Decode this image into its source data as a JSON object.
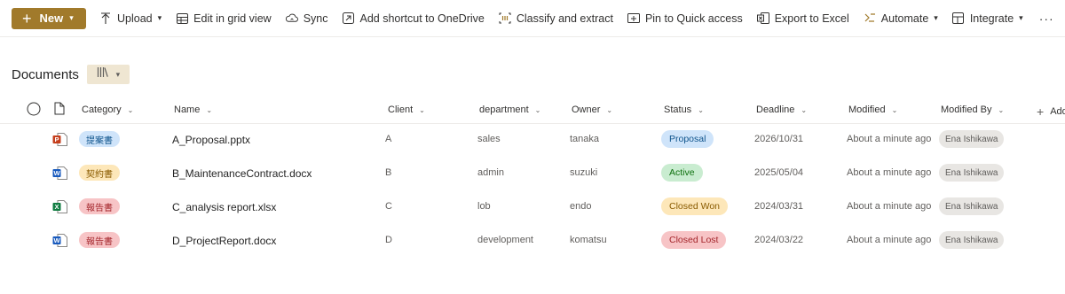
{
  "toolbar": {
    "new_label": "New",
    "upload_label": "Upload",
    "grid_label": "Edit in grid view",
    "sync_label": "Sync",
    "shortcut_label": "Add shortcut to OneDrive",
    "classify_label": "Classify and extract",
    "pin_label": "Pin to Quick access",
    "export_label": "Export to Excel",
    "automate_label": "Automate",
    "integrate_label": "Integrate",
    "more_label": "···"
  },
  "library": {
    "title": "Documents"
  },
  "columns": {
    "category": "Category",
    "name": "Name",
    "client": "Client",
    "department": "department",
    "owner": "Owner",
    "status": "Status",
    "deadline": "Deadline",
    "modified": "Modified",
    "modified_by": "Modified By",
    "add_column": "Add"
  },
  "files": [
    {
      "type": "pptx",
      "category": "提案書",
      "name": "A_Proposal.pptx",
      "client": "A",
      "department": "sales",
      "owner": "tanaka",
      "status": "Proposal",
      "deadline": "2026/10/31",
      "modified": "About a minute ago",
      "modified_by": "Ena Ishikawa"
    },
    {
      "type": "docx",
      "category": "契約書",
      "name": "B_MaintenanceContract.docx",
      "client": "B",
      "department": "admin",
      "owner": "suzuki",
      "status": "Active",
      "deadline": "2025/05/04",
      "modified": "About a minute ago",
      "modified_by": "Ena Ishikawa"
    },
    {
      "type": "xlsx",
      "category": "報告書",
      "name": "C_analysis report.xlsx",
      "client": "C",
      "department": "lob",
      "owner": "endo",
      "status": "Closed Won",
      "deadline": "2024/03/31",
      "modified": "About a minute ago",
      "modified_by": "Ena Ishikawa"
    },
    {
      "type": "docx",
      "category": "報告書",
      "name": "D_ProjectReport.docx",
      "client": "D",
      "department": "development",
      "owner": "komatsu",
      "status": "Closed Lost",
      "deadline": "2024/03/22",
      "modified": "About a minute ago",
      "modified_by": "Ena Ishikawa"
    }
  ],
  "colors": {
    "brand": "#a17a2b",
    "category_提案書": {
      "bg": "#cfe4fa",
      "fg": "#0f548c"
    },
    "category_契約書": {
      "bg": "#fde7b9",
      "fg": "#8a5b00"
    },
    "category_報告書": {
      "bg": "#f7c4c6",
      "fg": "#a4262c"
    },
    "status_Proposal": {
      "bg": "#cfe4fa",
      "fg": "#0f548c"
    },
    "status_Active": {
      "bg": "#c9ecd0",
      "fg": "#0e700e"
    },
    "status_Closed Won": {
      "bg": "#fde7b9",
      "fg": "#8a5b00"
    },
    "status_Closed Lost": {
      "bg": "#f7c4c6",
      "fg": "#a4262c"
    },
    "file_pptx": "#c43e1c",
    "file_docx": "#185abd",
    "file_xlsx": "#107c41"
  }
}
